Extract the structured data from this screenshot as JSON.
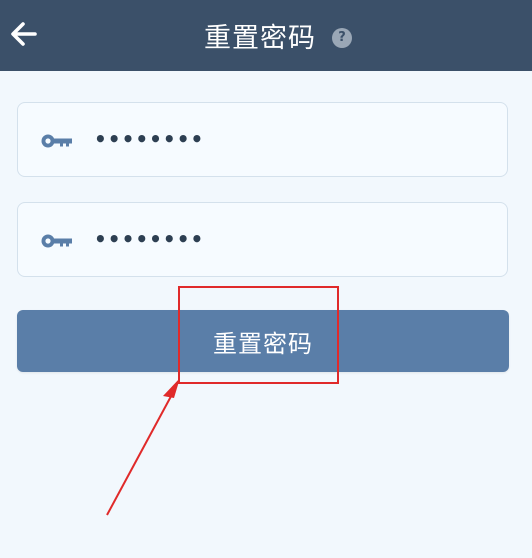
{
  "header": {
    "title": "重置密码",
    "help_glyph": "?",
    "back_icon": "arrow-left-icon",
    "background_color": "#3b5069"
  },
  "form": {
    "password_field": {
      "icon": "key-icon",
      "value": "••••••••"
    },
    "confirm_password_field": {
      "icon": "key-icon",
      "value": "••••••••"
    },
    "submit_label": "重置密码",
    "button_color": "#5a7ea8"
  },
  "annotation": {
    "highlight_color": "#e02a2a"
  }
}
